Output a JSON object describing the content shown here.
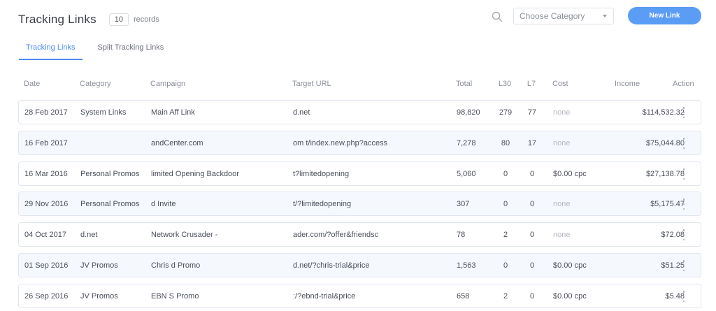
{
  "header": {
    "title": "Tracking Links",
    "record_count": "10",
    "records_label": "records"
  },
  "toolbar": {
    "search_icon": "search-icon",
    "category_placeholder": "Choose Category",
    "new_link_label": "New Link",
    "accent_color": "#5b9cf5"
  },
  "tabs": [
    {
      "label": "Tracking Links",
      "active": true
    },
    {
      "label": "Split Tracking Links",
      "active": false
    }
  ],
  "table": {
    "columns": [
      "Date",
      "Category",
      "Campaign",
      "Target URL",
      "Total",
      "L30",
      "L7",
      "Cost",
      "Income",
      "Action"
    ],
    "rows": [
      {
        "date": "28 Feb 2017",
        "category": "System Links",
        "campaign": "Main Aff Link",
        "target_url": "d.net",
        "total": "98,820",
        "l30": "279",
        "l7": "77",
        "cost": "none",
        "income": "$114,532.32"
      },
      {
        "date": "16 Feb 2017",
        "category": "",
        "campaign": "andCenter.com",
        "target_url": "om t/index.new.php?access",
        "total": "7,278",
        "l30": "80",
        "l7": "17",
        "cost": "none",
        "income": "$75,044.80"
      },
      {
        "date": "16 Mar 2016",
        "category": "Personal Promos",
        "campaign": "limited Opening Backdoor",
        "target_url": "t?limitedopening",
        "total": "5,060",
        "l30": "0",
        "l7": "0",
        "cost": "$0.00 cpc",
        "income": "$27,138.78"
      },
      {
        "date": "29 Nov 2016",
        "category": "Personal Promos",
        "campaign": "d Invite",
        "target_url": "t/?limitedopening",
        "total": "307",
        "l30": "0",
        "l7": "0",
        "cost": "none",
        "income": "$5,175.47"
      },
      {
        "date": "04 Oct 2017",
        "category": "d.net",
        "campaign": "Network Crusader -",
        "target_url": "ader.com/?offer&friendsc",
        "total": "78",
        "l30": "2",
        "l7": "0",
        "cost": "none",
        "income": "$72.08"
      },
      {
        "date": "01 Sep 2016",
        "category": "JV Promos",
        "campaign": "Chris d Promo",
        "target_url": "d.net/?chris-trial&price",
        "total": "1,563",
        "l30": "0",
        "l7": "0",
        "cost": "$0.00 cpc",
        "income": "$51.25"
      },
      {
        "date": "26 Sep 2016",
        "category": "JV Promos",
        "campaign": "EBN S Promo",
        "target_url": ":/?ebnd-trial&price",
        "total": "658",
        "l30": "2",
        "l7": "0",
        "cost": "$0.00 cpc",
        "income": "$5.48"
      }
    ]
  }
}
